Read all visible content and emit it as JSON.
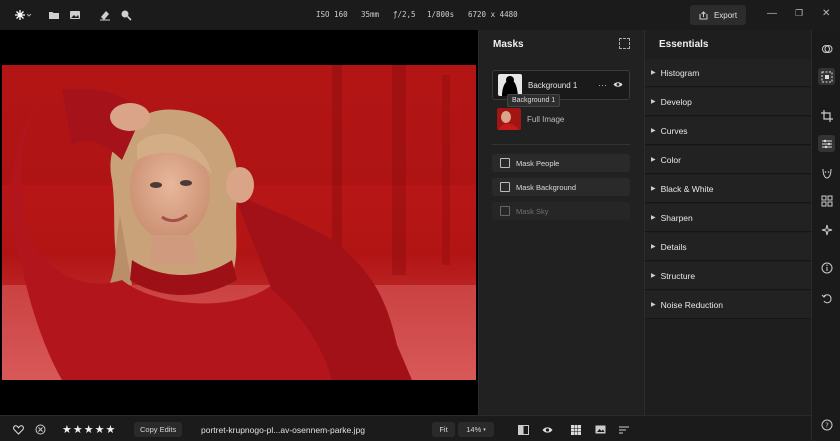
{
  "toolbar": {
    "camera_meta": {
      "iso": "ISO 160",
      "focal": "35mm",
      "aperture": "ƒ/2,5",
      "shutter": "1/800s",
      "dimensions": "6720 x 4480"
    },
    "export_label": "Export",
    "icons": [
      "app-menu-icon",
      "folder-icon",
      "image-icon",
      "eraser-icon",
      "clone-brush-icon"
    ]
  },
  "masks": {
    "title": "Masks",
    "layer": {
      "name": "Background 1",
      "tooltip": "Background 1"
    },
    "full_image_label": "Full Image",
    "buttons": [
      {
        "label": "Mask People",
        "enabled": true
      },
      {
        "label": "Mask Background",
        "enabled": true
      },
      {
        "label": "Mask Sky",
        "enabled": false
      }
    ]
  },
  "essentials": {
    "title": "Essentials",
    "sections": [
      "Histogram",
      "Develop",
      "Curves",
      "Color",
      "Black & White",
      "Sharpen",
      "Details",
      "Structure",
      "Noise Reduction"
    ]
  },
  "bottom": {
    "copy_edits_label": "Copy Edits",
    "filename": "portret-krupnogo-pl...av-osennem-parke.jpg",
    "fit_label": "Fit",
    "zoom_value": "14%",
    "rating": 5
  },
  "colors": {
    "accent_mask": "#c4161c",
    "panel_bg": "#212121",
    "app_bg": "#1b1b1b"
  }
}
